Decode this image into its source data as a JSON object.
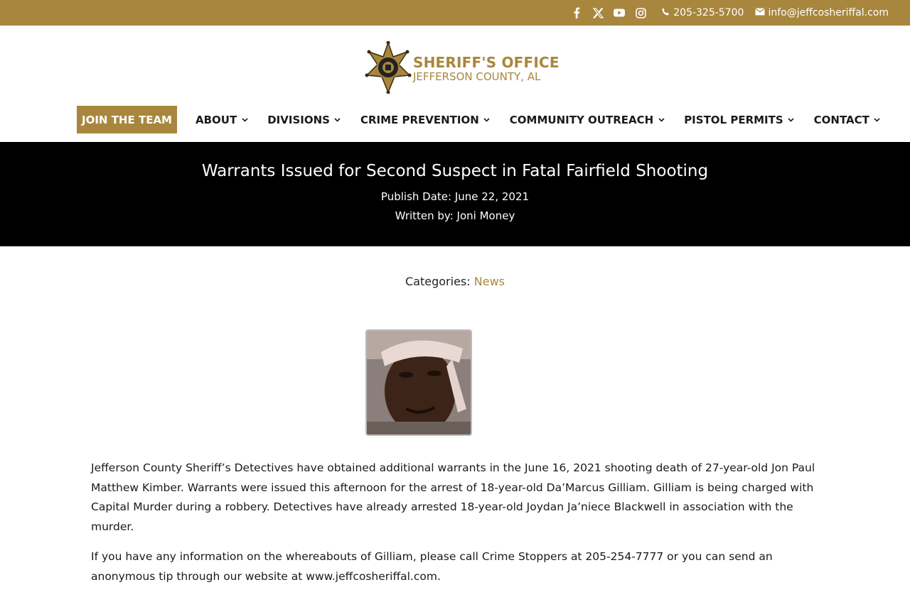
{
  "topbar": {
    "social": [
      {
        "name": "facebook-icon"
      },
      {
        "name": "x-icon"
      },
      {
        "name": "youtube-icon"
      },
      {
        "name": "instagram-icon"
      }
    ],
    "phone": "205-325-5700",
    "email": "info@jeffcosheriffal.com"
  },
  "logo": {
    "line1": "SHERIFF'S OFFICE",
    "line2": "JEFFERSON COUNTY, AL"
  },
  "nav": {
    "join": "JOIN THE TEAM",
    "items": [
      {
        "label": "ABOUT"
      },
      {
        "label": "DIVISIONS"
      },
      {
        "label": "CRIME PREVENTION"
      },
      {
        "label": "COMMUNITY OUTREACH"
      },
      {
        "label": "PISTOL PERMITS"
      },
      {
        "label": "CONTACT"
      }
    ]
  },
  "post": {
    "title": "Warrants Issued for Second Suspect in Fatal Fairfield Shooting",
    "publish_date": "Publish Date: June 22, 2021",
    "author": "Written by: Joni Money",
    "categories_label": "Categories:",
    "category": "News",
    "paragraphs": [
      "Jefferson County Sheriff’s Detectives have obtained additional warrants in the June 16, 2021 shooting death of 27-year-old Jon Paul Matthew Kimber.  Warrants were issued this afternoon for the arrest of 18-year-old Da’Marcus Gilliam.  Gilliam is being charged with Capital Murder during a robbery.  Detectives have already arrested 18-year-old Joydan Ja’niece Blackwell in association with the murder.",
      "If you have any information on the whereabouts of Gilliam, please call Crime Stoppers at 205-254-7777 or you can send an anonymous tip through our website at www.jeffcosheriffal.com."
    ]
  },
  "colors": {
    "brand_gold": "#a8863d",
    "hero_bg": "#000000"
  }
}
